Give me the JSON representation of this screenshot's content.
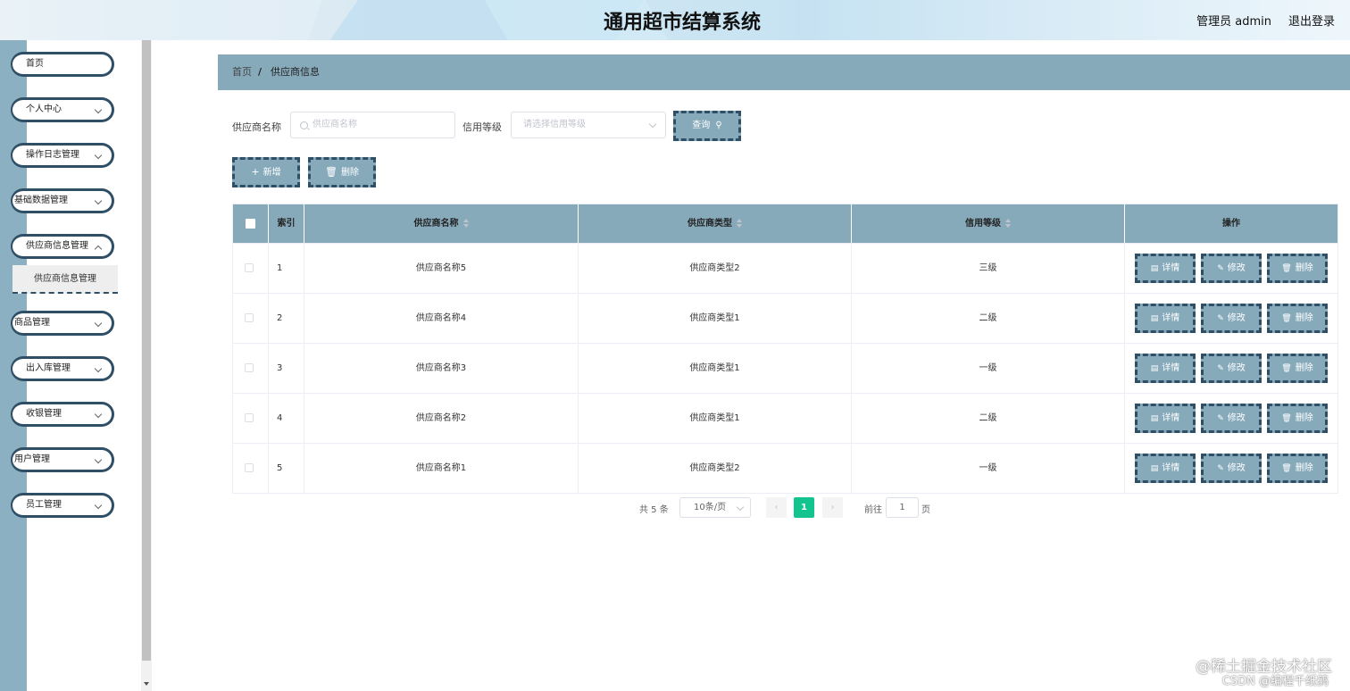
{
  "header": {
    "title": "通用超市结算系统",
    "user": "管理员 admin",
    "logout": "退出登录"
  },
  "sidebar": {
    "items": [
      {
        "label": "首页",
        "expandable": false
      },
      {
        "label": "个人中心",
        "expandable": true
      },
      {
        "label": "操作日志管理",
        "expandable": true
      },
      {
        "label": "基础数据管理",
        "expandable": true
      },
      {
        "label": "供应商信息管理",
        "expandable": true,
        "expanded": true
      },
      {
        "label": "商品管理",
        "expandable": true
      },
      {
        "label": "出入库管理",
        "expandable": true
      },
      {
        "label": "收银管理",
        "expandable": true
      },
      {
        "label": "用户管理",
        "expandable": true
      },
      {
        "label": "员工管理",
        "expandable": true
      }
    ],
    "submenu": {
      "label": "供应商信息管理"
    }
  },
  "breadcrumb": {
    "home": "首页",
    "separator": "/",
    "current": "供应商信息"
  },
  "search": {
    "name_label": "供应商名称",
    "name_placeholder": "供应商名称",
    "level_label": "信用等级",
    "level_placeholder": "请选择信用等级",
    "query_button": "查询"
  },
  "actions": {
    "add": "新增",
    "delete": "删除"
  },
  "table": {
    "columns": {
      "index": "索引",
      "name": "供应商名称",
      "type": "供应商类型",
      "level": "信用等级",
      "ops": "操作"
    },
    "rows": [
      {
        "index": "1",
        "name": "供应商名称5",
        "type": "供应商类型2",
        "level": "三级"
      },
      {
        "index": "2",
        "name": "供应商名称4",
        "type": "供应商类型1",
        "level": "二级"
      },
      {
        "index": "3",
        "name": "供应商名称3",
        "type": "供应商类型1",
        "level": "一级"
      },
      {
        "index": "4",
        "name": "供应商名称2",
        "type": "供应商类型1",
        "level": "二级"
      },
      {
        "index": "5",
        "name": "供应商名称1",
        "type": "供应商类型2",
        "level": "一级"
      }
    ],
    "row_buttons": {
      "detail": "详情",
      "edit": "修改",
      "delete": "删除"
    }
  },
  "pagination": {
    "total": "共 5 条",
    "page_size": "10条/页",
    "current_page": "1",
    "goto_prefix": "前往",
    "goto_value": "1",
    "goto_suffix": "页"
  },
  "watermark": {
    "line1": "@稀土掘金技术社区",
    "line2": "CSDN @编程千纸鹤"
  },
  "colors": {
    "accent": "#87aabb",
    "border_dark": "#2f4f66",
    "active_page": "#13c48e"
  }
}
